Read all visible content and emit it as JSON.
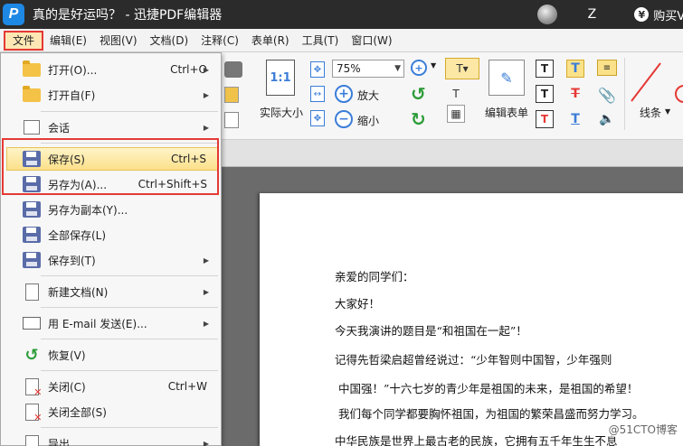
{
  "titlebar": {
    "doc_title": "真的是好运吗？ - 迅捷PDF编辑器",
    "user_initial": "Z",
    "buy_label": "购买VI"
  },
  "menubar": {
    "items": [
      "文件",
      "编辑(E)",
      "视图(V)",
      "文档(D)",
      "注释(C)",
      "表单(R)",
      "工具(T)",
      "窗口(W)"
    ]
  },
  "toolbar": {
    "zoom_value": "75%",
    "actual_size_label": "实际大小",
    "actual_size_icon_text": "1:1",
    "zoom_in_label": "放大",
    "zoom_out_label": "缩小",
    "edit_form_label": "编辑表单",
    "line_label": "线条"
  },
  "file_menu": {
    "items": [
      {
        "label": "打开(O)...",
        "shortcut": "Ctrl+O",
        "submenu": true
      },
      {
        "label": "打开自(F)",
        "shortcut": "",
        "submenu": true
      },
      {
        "label": "会话",
        "shortcut": "",
        "submenu": true
      },
      {
        "label": "保存(S)",
        "shortcut": "Ctrl+S",
        "submenu": false
      },
      {
        "label": "另存为(A)...",
        "shortcut": "Ctrl+Shift+S",
        "submenu": false
      },
      {
        "label": "另存为副本(Y)...",
        "shortcut": "",
        "submenu": false
      },
      {
        "label": "全部保存(L)",
        "shortcut": "",
        "submenu": false
      },
      {
        "label": "保存到(T)",
        "shortcut": "",
        "submenu": true
      },
      {
        "label": "新建文档(N)",
        "shortcut": "",
        "submenu": true
      },
      {
        "label": "用 E-mail 发送(E)...",
        "shortcut": "",
        "submenu": true
      },
      {
        "label": "恢复(V)",
        "shortcut": "",
        "submenu": false
      },
      {
        "label": "关闭(C)",
        "shortcut": "Ctrl+W",
        "submenu": false
      },
      {
        "label": "关闭全部(S)",
        "shortcut": "",
        "submenu": false
      },
      {
        "label": "导出",
        "shortcut": "",
        "submenu": true
      }
    ]
  },
  "document": {
    "lines": [
      "亲爱的同学们：",
      "大家好！",
      "今天我演讲的题目是“和祖国在一起”！",
      "记得先哲梁启超曾经说过：“少年智则中国智，少年强则",
      "中国强！”十六七岁的青少年是祖国的未来，是祖国的希望！",
      "我们每个同学都要胸怀祖国，为祖国的繁荣昌盛而努力学习。",
      "中华民族是世界上最古老的民族，它拥有五千年生生不息"
    ],
    "watermark": "@51CTO博客"
  },
  "colors": {
    "titlebar_bg": "#2b2b2b",
    "highlight_box": "#e53935",
    "accent_blue": "#3b7dd8"
  }
}
